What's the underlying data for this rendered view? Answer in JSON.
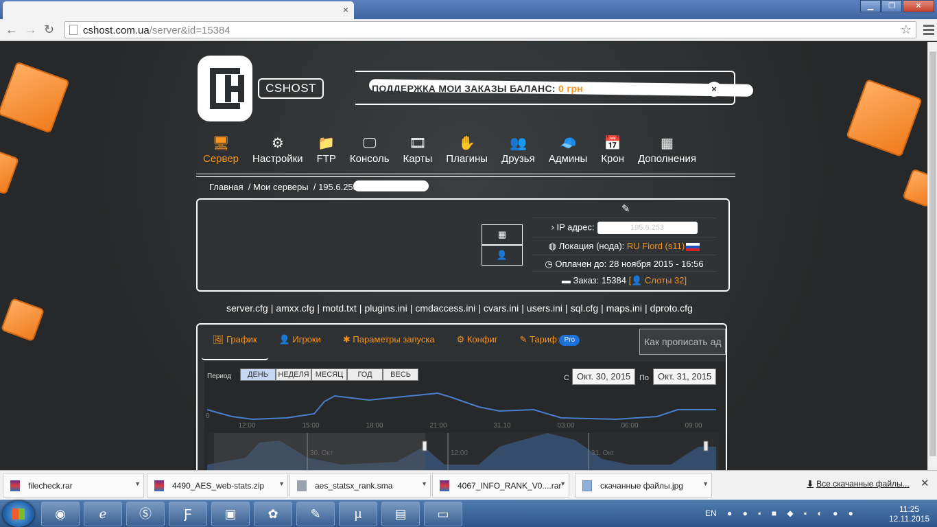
{
  "browser": {
    "tab_close": "×",
    "url_host": "cshost.com.ua",
    "url_path": "/server&id=15384",
    "back": "←",
    "forward": "→",
    "reload": "↻",
    "star": "☆",
    "win_min": "▁",
    "win_max": "❐",
    "win_close": "✕"
  },
  "header": {
    "brand": "CSHOST",
    "top_text": "ПОДДЕРЖКА МОИ ЗАКАЗЫ БАЛАНС:",
    "top_accent": "0 грн",
    "close_icon": "×"
  },
  "nav": [
    {
      "label": "Сервер",
      "icon": "🖥",
      "active": true
    },
    {
      "label": "Настройки",
      "icon": "⚙"
    },
    {
      "label": "FTP",
      "icon": "📁"
    },
    {
      "label": "Консоль",
      "icon": "🖵"
    },
    {
      "label": "Карты",
      "icon": "🎞"
    },
    {
      "label": "Плагины",
      "icon": "✋"
    },
    {
      "label": "Друзья",
      "icon": "👥"
    },
    {
      "label": "Админы",
      "icon": "🧢"
    },
    {
      "label": "Крон",
      "icon": "📅"
    },
    {
      "label": "Дополнения",
      "icon": "▦"
    }
  ],
  "breadcrumb": {
    "home": "Главная",
    "sep": "/",
    "servers": "Мои серверы",
    "current": "195.6.253"
  },
  "server_card": {
    "edit_icon": "✎",
    "calendar_icon": "▦",
    "user_icon": "👤",
    "ip_label": "IP адрес:",
    "ip_value": "195.6.253",
    "location_label": "Локация (нода):",
    "location_value": "RU Fiord (s11)",
    "paid_label": "Оплачен до:",
    "paid_value": "28 ноября 2015 - 16:56",
    "order_label": "Заказ: 15384",
    "slots": "Слоты 32"
  },
  "config_files": [
    "server.cfg",
    "amxx.cfg",
    "motd.txt",
    "plugins.ini",
    "cmdaccess.ini",
    "cvars.ini",
    "users.ini",
    "sql.cfg",
    "maps.ini",
    "dproto.cfg"
  ],
  "tabs": [
    {
      "label": "График",
      "icon": "🖼",
      "active": true
    },
    {
      "label": "Игроки",
      "icon": "👤"
    },
    {
      "label": "Параметры запуска",
      "icon": "✱"
    },
    {
      "label": "Конфиг",
      "icon": "⚙"
    },
    {
      "label": "Тариф:",
      "icon": "✎",
      "badge": "Pro"
    }
  ],
  "how_button": "Как прописать ад",
  "period": {
    "label": "Период",
    "ranges": [
      "ДЕНЬ",
      "НЕДЕЛЯ",
      "МЕСЯЦ",
      "ГОД",
      "ВЕСЬ"
    ],
    "from_label": "С",
    "from_value": "Окт. 30, 2015",
    "to_label": "По",
    "to_value": "Окт. 31, 2015"
  },
  "chart_data": {
    "type": "area",
    "x_ticks": [
      "12:00",
      "15:00",
      "18:00",
      "21:00",
      "31.10",
      "03:00",
      "06:00",
      "09:00"
    ],
    "y_tick": "0",
    "nav_labels": [
      "30. Окт",
      "12:00",
      "31. Окт"
    ],
    "line_color": "#4a7fd0"
  },
  "downloads": {
    "items": [
      {
        "name": "filecheck.rar",
        "type": "rar"
      },
      {
        "name": "4490_AES_web-stats.zip",
        "type": "rar"
      },
      {
        "name": "aes_statsx_rank.sma",
        "type": "sma"
      },
      {
        "name": "4067_INFO_RANK_V0....rar",
        "type": "rar"
      },
      {
        "name": "скачанные файлы.jpg",
        "type": "jpg"
      }
    ],
    "all_label": "Все скачанные файлы...",
    "all_icon": "⬇",
    "close": "✕"
  },
  "taskbar": {
    "apps": [
      "chrome",
      "ie",
      "skype",
      "filezilla",
      "photos",
      "icq",
      "notepad",
      "utorrent",
      "winrar",
      "explorer"
    ],
    "lang": "EN",
    "time": "11:25",
    "date": "12.11.2015"
  }
}
